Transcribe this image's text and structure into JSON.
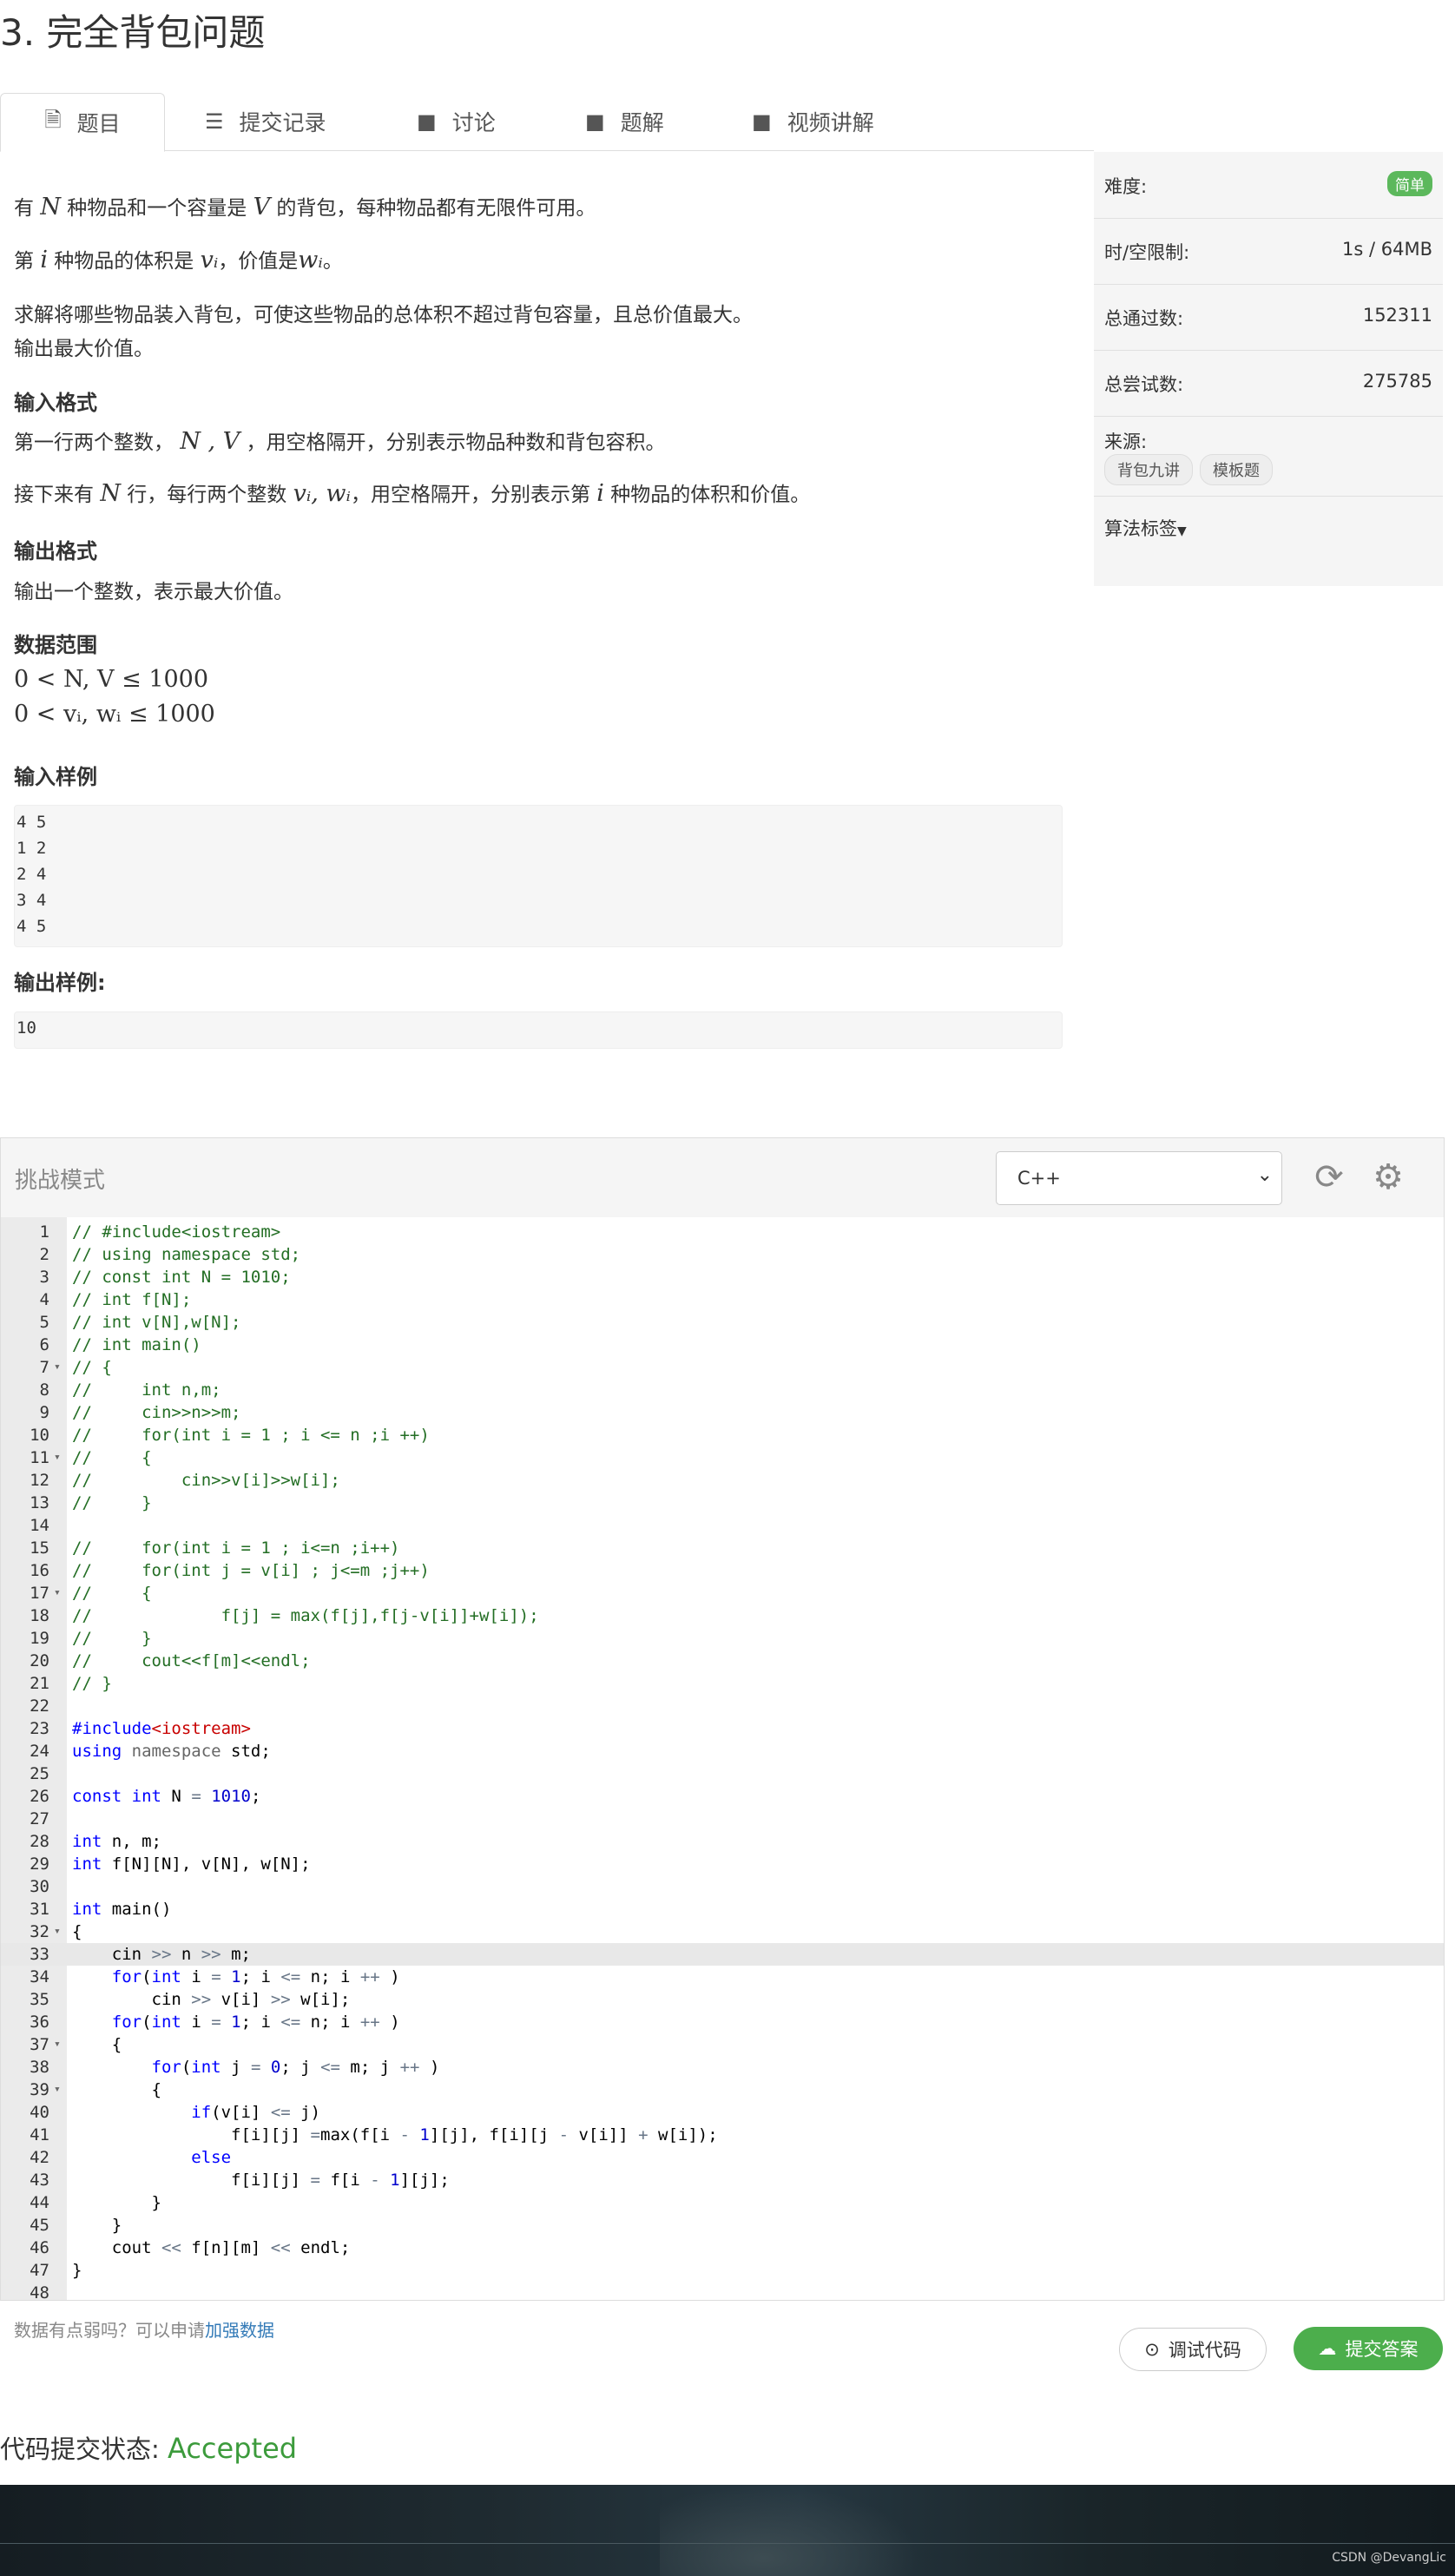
{
  "page": {
    "title": "3. 完全背包问题"
  },
  "tabs": [
    {
      "label": "题目",
      "icon": "document-icon"
    },
    {
      "label": "提交记录",
      "icon": "list-icon"
    },
    {
      "label": "讨论",
      "icon": "comment-icon"
    },
    {
      "label": "题解",
      "icon": "book-icon"
    },
    {
      "label": "视频讲解",
      "icon": "book-icon"
    }
  ],
  "problem": {
    "p1_a": "有",
    "p1_m1": "N",
    "p1_b": "种物品和一个容量是",
    "p1_m2": "V",
    "p1_c": "的背包，每种物品都有无限件可用。",
    "p2_a": "第",
    "p2_m1": "i",
    "p2_b": "种物品的体积是",
    "p2_m2": "vᵢ",
    "p2_c": "，价值是",
    "p2_m3": "wᵢ",
    "p2_d": "。",
    "p3": "求解将哪些物品装入背包，可使这些物品的总体积不超过背包容量，且总价值最大。",
    "p4": "输出最大价值。",
    "input_heading": "输入格式",
    "in1_a": "第一行两个整数，",
    "in1_m": "N , V",
    "in1_b": "，用空格隔开，分别表示物品种数和背包容积。",
    "in2_a": "接下来有",
    "in2_m1": "N",
    "in2_b": "行，每行两个整数",
    "in2_m2": "vᵢ, wᵢ",
    "in2_c": "，用空格隔开，分别表示第",
    "in2_m3": "i",
    "in2_d": "种物品的体积和价值。",
    "output_heading": "输出格式",
    "out1": "输出一个整数，表示最大价值。",
    "range_heading": "数据范围",
    "range1": "0 < N, V ≤ 1000",
    "range2": "0 < vᵢ, wᵢ ≤ 1000",
    "sample_in_heading": "输入样例",
    "sample_in": [
      "4 5",
      "1 2",
      "2 4",
      "3 4",
      "4 5"
    ],
    "sample_out_heading": "输出样例:",
    "sample_out": [
      "10"
    ]
  },
  "sidebar": {
    "difficulty_label": "难度:",
    "difficulty_value": "简单",
    "limit_label": "时/空限制:",
    "limit_value": "1s / 64MB",
    "pass_label": "总通过数:",
    "pass_value": "152311",
    "try_label": "总尝试数:",
    "try_value": "275785",
    "source_label": "来源:",
    "source_tags": [
      "背包九讲",
      "模板题"
    ],
    "algo_label": "算法标签"
  },
  "editor": {
    "mode_label": "挑战模式",
    "language": "C++",
    "refresh_icon": "refresh-icon",
    "settings_icon": "gear-icon",
    "lines": [
      "// #include<iostream>",
      "// using namespace std;",
      "// const int N = 1010;",
      "// int f[N];",
      "// int v[N],w[N];",
      "// int main()",
      "// {",
      "//     int n,m;",
      "//     cin>>n>>m;",
      "//     for(int i = 1 ; i <= n ;i ++)",
      "//     {",
      "//         cin>>v[i]>>w[i];",
      "//     }",
      "",
      "//     for(int i = 1 ; i<=n ;i++)",
      "//     for(int j = v[i] ; j<=m ;j++)",
      "//     {",
      "//             f[j] = max(f[j],f[j-v[i]]+w[i]);",
      "//     }",
      "//     cout<<f[m]<<endl;",
      "// }",
      "",
      "#include<iostream>",
      "using namespace std;",
      "",
      "const int N = 1010;",
      "",
      "int n, m;",
      "int f[N][N], v[N], w[N];",
      "",
      "int main()",
      "{",
      "    cin >> n >> m;",
      "    for(int i = 1; i <= n; i ++ )",
      "        cin >> v[i] >> w[i];",
      "    for(int i = 1; i <= n; i ++ )",
      "    {",
      "        for(int j = 0; j <= m; j ++ )",
      "        {",
      "            if(v[i] <= j)",
      "                f[i][j] =max(f[i - 1][j], f[i][j - v[i]] + w[i]);",
      "            else",
      "                f[i][j] = f[i - 1][j];",
      "        }",
      "    }",
      "    cout << f[n][m] << endl;",
      "}",
      ""
    ]
  },
  "actions": {
    "hint_text": "数据有点弱吗？可以申请",
    "hint_link": "加强数据",
    "debug_label": "调试代码",
    "submit_label": "提交答案"
  },
  "result": {
    "label": "代码提交状态:",
    "value": "Accepted"
  },
  "footer": {
    "watermark": "CSDN @DevangLic"
  }
}
